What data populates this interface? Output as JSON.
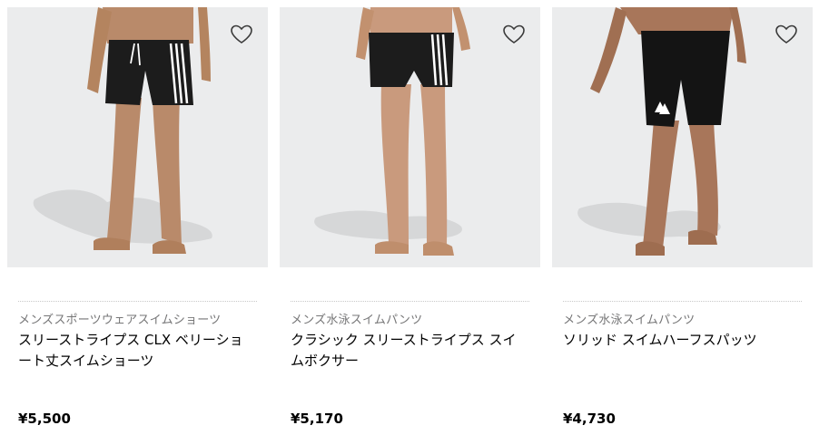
{
  "products": [
    {
      "category": "メンズスポーツウェアスイムショーツ",
      "title": "スリーストライプス CLX ベリーショート丈スイムショーツ",
      "price": "¥5,500",
      "wishlist_icon": "heart-outline-icon",
      "image": "model wearing black swim shorts with white three stripes and white drawstring"
    },
    {
      "category": "メンズ水泳スイムパンツ",
      "title": "クラシック スリーストライプス スイムボクサー",
      "price": "¥5,170",
      "wishlist_icon": "heart-outline-icon",
      "image": "model wearing black swim boxer briefs with white three stripes"
    },
    {
      "category": "メンズ水泳スイムパンツ",
      "title": "ソリッド スイムハーフスパッツ",
      "price": "¥4,730",
      "wishlist_icon": "heart-outline-icon",
      "image": "model wearing black knee-length swim jammers with white logo"
    }
  ],
  "colors": {
    "image_bg": "#ebeced",
    "swimwear": "#1c1c1c",
    "stripe": "#ffffff",
    "category_text": "#767677"
  }
}
